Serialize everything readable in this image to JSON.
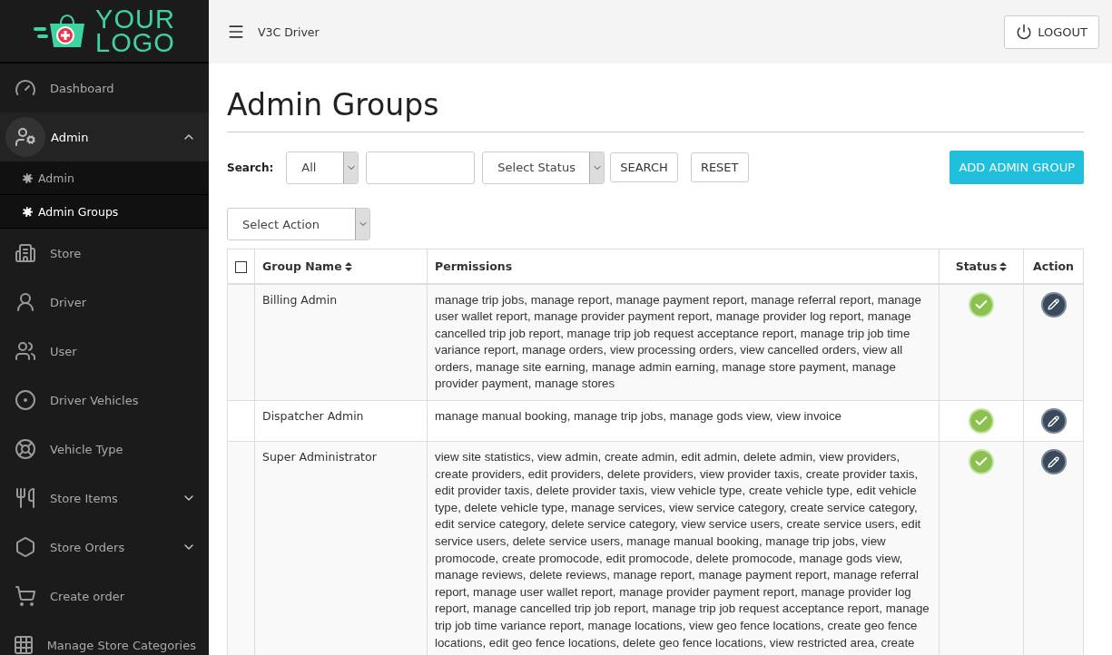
{
  "logo": {
    "line1": "YOUR",
    "line2": "LOGO"
  },
  "sidebar": {
    "items": [
      {
        "label": "Dashboard",
        "selected": false
      },
      {
        "label": "Admin",
        "selected": true,
        "expanded": true,
        "children": [
          {
            "label": "Admin",
            "selected": false
          },
          {
            "label": "Admin Groups",
            "selected": true
          }
        ]
      },
      {
        "label": "Store",
        "selected": false
      },
      {
        "label": "Driver",
        "selected": false
      },
      {
        "label": "User",
        "selected": false
      },
      {
        "label": "Driver Vehicles",
        "selected": false
      },
      {
        "label": "Vehicle Type",
        "selected": false
      },
      {
        "label": "Store Items",
        "selected": false,
        "expanded": false
      },
      {
        "label": "Store Orders",
        "selected": false,
        "expanded": false
      },
      {
        "label": "Create order",
        "selected": false
      },
      {
        "label": "Manage Store Categories",
        "selected": false
      }
    ]
  },
  "topbar": {
    "title": "V3C Driver",
    "logout": "LOGOUT"
  },
  "page": {
    "title": "Admin Groups",
    "search": {
      "label": "Search:",
      "filter": "All",
      "status_placeholder": "Select Status",
      "buttons": [
        "SEARCH",
        "RESET"
      ]
    },
    "add_button": "ADD ADMIN GROUP",
    "action_select": "Select Action"
  },
  "table": {
    "select_all_checked": false,
    "columns": [
      {
        "label": "Group Name",
        "sortable": true
      },
      {
        "label": "Permissions",
        "sortable": false
      },
      {
        "label": "Status",
        "sortable": true
      },
      {
        "label": "Action",
        "sortable": false
      }
    ],
    "rows": [
      {
        "name": "Billing Admin",
        "permissions": "manage trip jobs, manage report, manage payment report, manage referral report, manage user wallet report, manage provider payment report, manage provider log report, manage cancelled trip job report, manage trip job request acceptance report, manage trip job time variance report, manage orders, view processing orders, view cancelled orders, view all orders, manage site earning, manage admin earning, manage store payment, manage provider payment, manage stores",
        "active": true
      },
      {
        "name": "Dispatcher Admin",
        "permissions": "manage manual booking, manage trip jobs, manage gods view, view invoice",
        "active": true
      },
      {
        "name": "Super Administrator",
        "permissions": "view site statistics, view admin, create admin, edit admin, delete admin, view providers, create providers, edit providers, delete providers, view provider taxis, create provider taxis, edit provider taxis, delete provider taxis, view vehicle type, create vehicle type, edit vehicle type, delete vehicle type, manage services, view service category, create service category, edit service category, delete service category, view service users, create service users, edit service users, delete service users, manage manual booking, manage trip jobs, view promocode, create promocode, edit promocode, delete promocode, manage gods view, manage reviews, delete reviews, manage report, manage payment report, manage referral report, manage user wallet report, manage provider payment report, manage provider log report, manage cancelled trip job report, manage trip job request acceptance report, manage trip job time variance report, manage locations, view geo fence locations, create geo fence locations, edit geo fence locations, delete geo fence locations, view restricted area, create",
        "active": true
      }
    ]
  }
}
